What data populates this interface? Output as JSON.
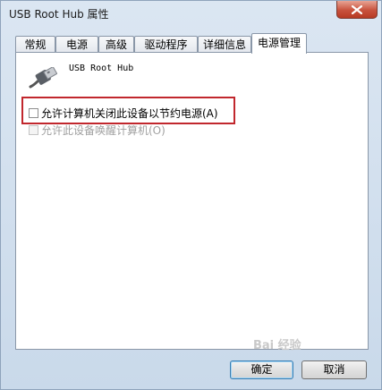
{
  "window": {
    "title": "USB Root Hub 属性"
  },
  "tabs": [
    {
      "label": "常规"
    },
    {
      "label": "电源"
    },
    {
      "label": "高级"
    },
    {
      "label": "驱动程序"
    },
    {
      "label": "详细信息"
    },
    {
      "label": "电源管理"
    }
  ],
  "active_tab": "电源管理",
  "device": {
    "name": "USB Root Hub",
    "icon": "usb-connector-icon"
  },
  "options": [
    {
      "label": "允许计算机关闭此设备以节约电源(A)",
      "checked": false,
      "enabled": true
    },
    {
      "label": "允许此设备唤醒计算机(O)",
      "checked": false,
      "enabled": false
    }
  ],
  "buttons": {
    "ok": "确定",
    "cancel": "取消"
  },
  "watermark": "Bai 经验",
  "colors": {
    "highlight": "#c1272d",
    "close": "#c8523d"
  }
}
